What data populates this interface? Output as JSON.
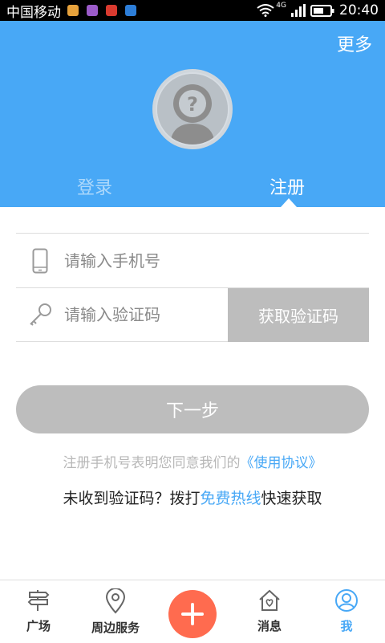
{
  "status_bar": {
    "carrier": "中国移动",
    "network": "4G",
    "time": "20:40"
  },
  "header": {
    "more_label": "更多",
    "tabs": [
      {
        "label": "登录",
        "active": false
      },
      {
        "label": "注册",
        "active": true
      }
    ]
  },
  "form": {
    "phone_placeholder": "请输入手机号",
    "code_placeholder": "请输入验证码",
    "get_code_label": "获取验证码",
    "next_label": "下一步"
  },
  "agreement": {
    "text": "注册手机号表明您同意我们的",
    "link": "《使用协议》"
  },
  "hotline": {
    "prefix": "未收到验证码？拨打",
    "link": "免费热线",
    "suffix": "快速获取"
  },
  "bottom_nav": {
    "items": [
      {
        "label": "广场",
        "icon": "square-signpost-icon"
      },
      {
        "label": "周边服务",
        "icon": "location-pin-icon"
      },
      {
        "label": "",
        "icon": "plus-icon"
      },
      {
        "label": "消息",
        "icon": "house-heart-icon"
      },
      {
        "label": "我",
        "icon": "user-icon",
        "active": true
      }
    ]
  },
  "colors": {
    "primary": "#48a8f6",
    "disabled": "#bdbdbd",
    "plus": "#ff6b4f"
  }
}
